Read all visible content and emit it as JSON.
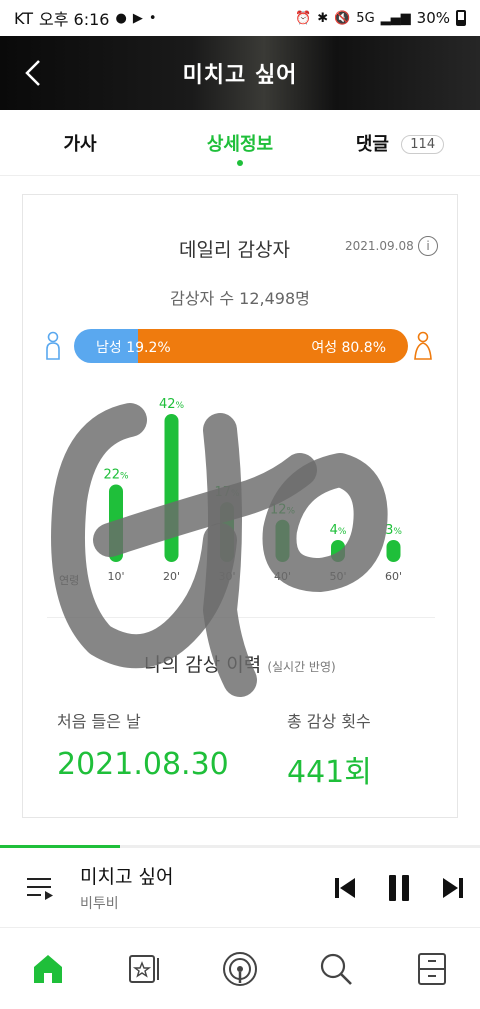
{
  "status_bar": {
    "carrier": "KT",
    "time": "오후 6:16",
    "battery": "30%",
    "network": "5G"
  },
  "header": {
    "title": "미치고 싶어",
    "back_icon": "chevron-left-icon"
  },
  "tabs": [
    {
      "label": "가사",
      "active": false
    },
    {
      "label": "상세정보",
      "active": true
    },
    {
      "label": "댓글",
      "active": false,
      "badge": "114"
    }
  ],
  "daily": {
    "title": "데일리 감상자",
    "date": "2021.09.08",
    "listeners": "감상자 수 12,498명",
    "male_label": "남성 19.2%",
    "female_label": "여성 80.8%",
    "male_ratio": 0.192,
    "male_color": "#5aa8ef",
    "female_color": "#ef7b0e"
  },
  "chart_data": {
    "type": "bar",
    "categories": [
      "10'",
      "20'",
      "30'",
      "40'",
      "50'",
      "60'"
    ],
    "values": [
      22,
      42,
      17,
      12,
      4,
      3
    ],
    "value_labels": [
      "22",
      "42",
      "17",
      "12",
      "4",
      "3"
    ],
    "unit": "%",
    "xlabel": "연령",
    "colors": [
      "#1fbf3a",
      "#1fbf3a",
      "#1fbf3a",
      "#1fbf3a",
      "#1fbf3a",
      "#1fbf3a"
    ]
  },
  "history": {
    "title": "나의 감상 이력",
    "note": "(실시간 반영)",
    "first_label": "처음 들은 날",
    "first_value": "2021.08.30",
    "count_label": "총 감상 횟수",
    "count_value": "441회"
  },
  "player": {
    "title": "미치고 싶어",
    "artist": "비투비",
    "progress": 0.25
  },
  "accent_color": "#1fbf3a"
}
